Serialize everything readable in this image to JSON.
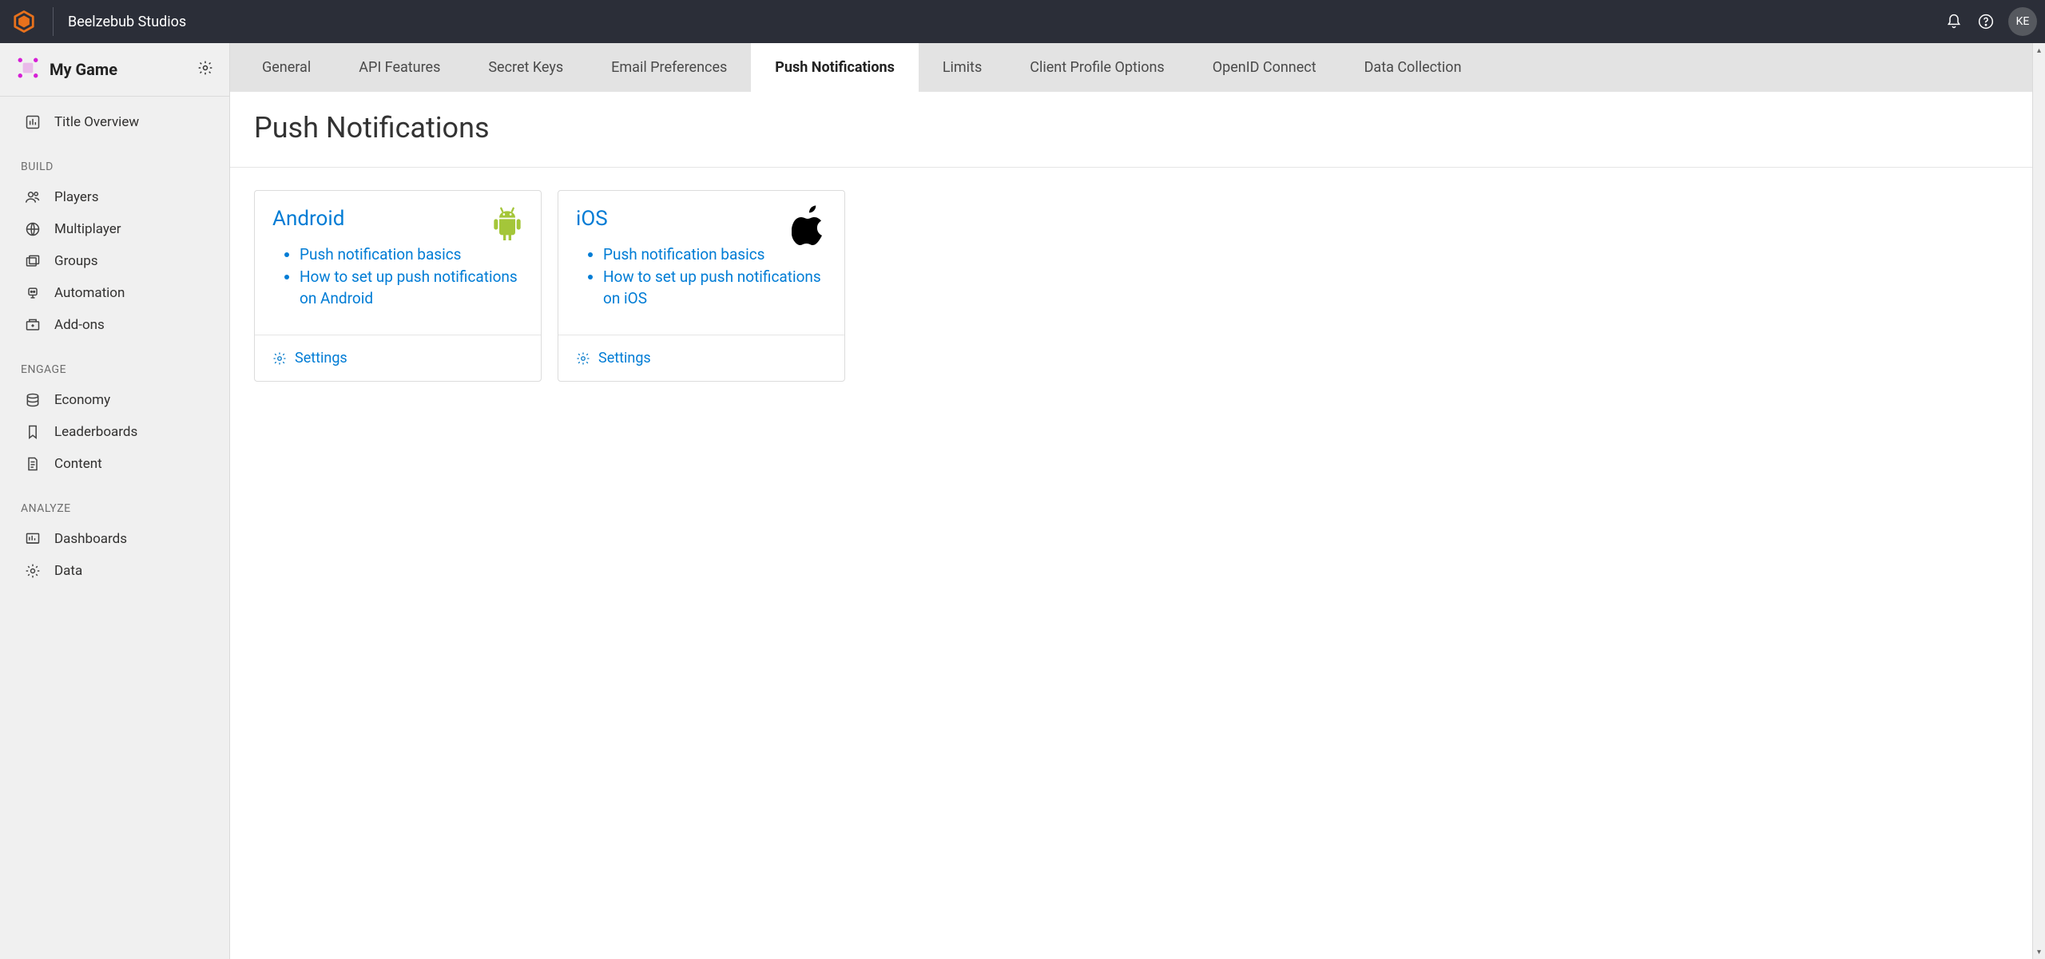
{
  "header": {
    "studio_name": "Beelzebub Studios",
    "avatar_initials": "KE"
  },
  "sidebar": {
    "game_title": "My Game",
    "top_item": "Title Overview",
    "sections": [
      {
        "label": "BUILD",
        "items": [
          "Players",
          "Multiplayer",
          "Groups",
          "Automation",
          "Add-ons"
        ]
      },
      {
        "label": "ENGAGE",
        "items": [
          "Economy",
          "Leaderboards",
          "Content"
        ]
      },
      {
        "label": "ANALYZE",
        "items": [
          "Dashboards",
          "Data"
        ]
      }
    ]
  },
  "tabs": [
    {
      "label": "General",
      "active": false
    },
    {
      "label": "API Features",
      "active": false
    },
    {
      "label": "Secret Keys",
      "active": false
    },
    {
      "label": "Email Preferences",
      "active": false
    },
    {
      "label": "Push Notifications",
      "active": true
    },
    {
      "label": "Limits",
      "active": false
    },
    {
      "label": "Client Profile Options",
      "active": false
    },
    {
      "label": "OpenID Connect",
      "active": false
    },
    {
      "label": "Data Collection",
      "active": false
    }
  ],
  "page": {
    "title": "Push Notifications",
    "cards": [
      {
        "title": "Android",
        "links": [
          "Push notification basics",
          "How to set up push notifications on Android"
        ],
        "footer": "Settings"
      },
      {
        "title": "iOS",
        "links": [
          "Push notification basics",
          "How to set up push notifications on iOS"
        ],
        "footer": "Settings"
      }
    ]
  }
}
